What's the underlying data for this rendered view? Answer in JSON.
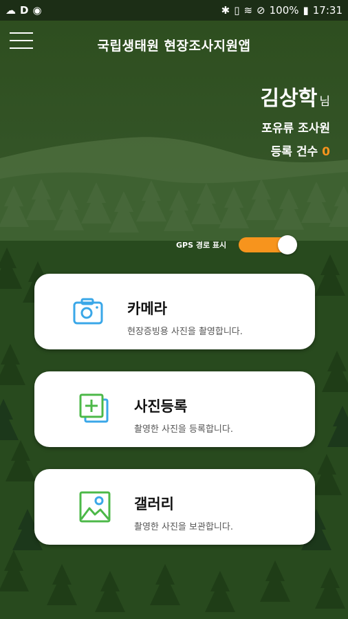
{
  "status_bar": {
    "left_icons": [
      "cloud-icon",
      "d-icon",
      "notification-icon"
    ],
    "right_icons": [
      "bluetooth-icon",
      "vibrate-icon",
      "wifi-icon",
      "do-not-disturb-icon"
    ],
    "battery": "100%",
    "time": "17:31"
  },
  "header": {
    "title": "국립생태원 현장조사지원앱"
  },
  "user": {
    "name": "김상학",
    "honorific": "님",
    "role": "포유류 조사원",
    "count_label": "등록 건수",
    "count_value": "0"
  },
  "gps": {
    "label": "GPS 경로 표시",
    "enabled": true
  },
  "menu_cards": [
    {
      "title": "카메라",
      "subtitle": "현장증빙용 사진을 촬영합니다.",
      "icon": "camera-icon"
    },
    {
      "title": "사진등록",
      "subtitle": "촬영한 사진을 등록합니다.",
      "icon": "add-photo-icon"
    },
    {
      "title": "갤러리",
      "subtitle": "촬영한 사진을 보관합니다.",
      "icon": "gallery-icon"
    }
  ],
  "colors": {
    "accent": "#f7941d",
    "icon_blue": "#3aa7e8",
    "icon_green": "#4cb848",
    "background": "#2b4a1f"
  }
}
